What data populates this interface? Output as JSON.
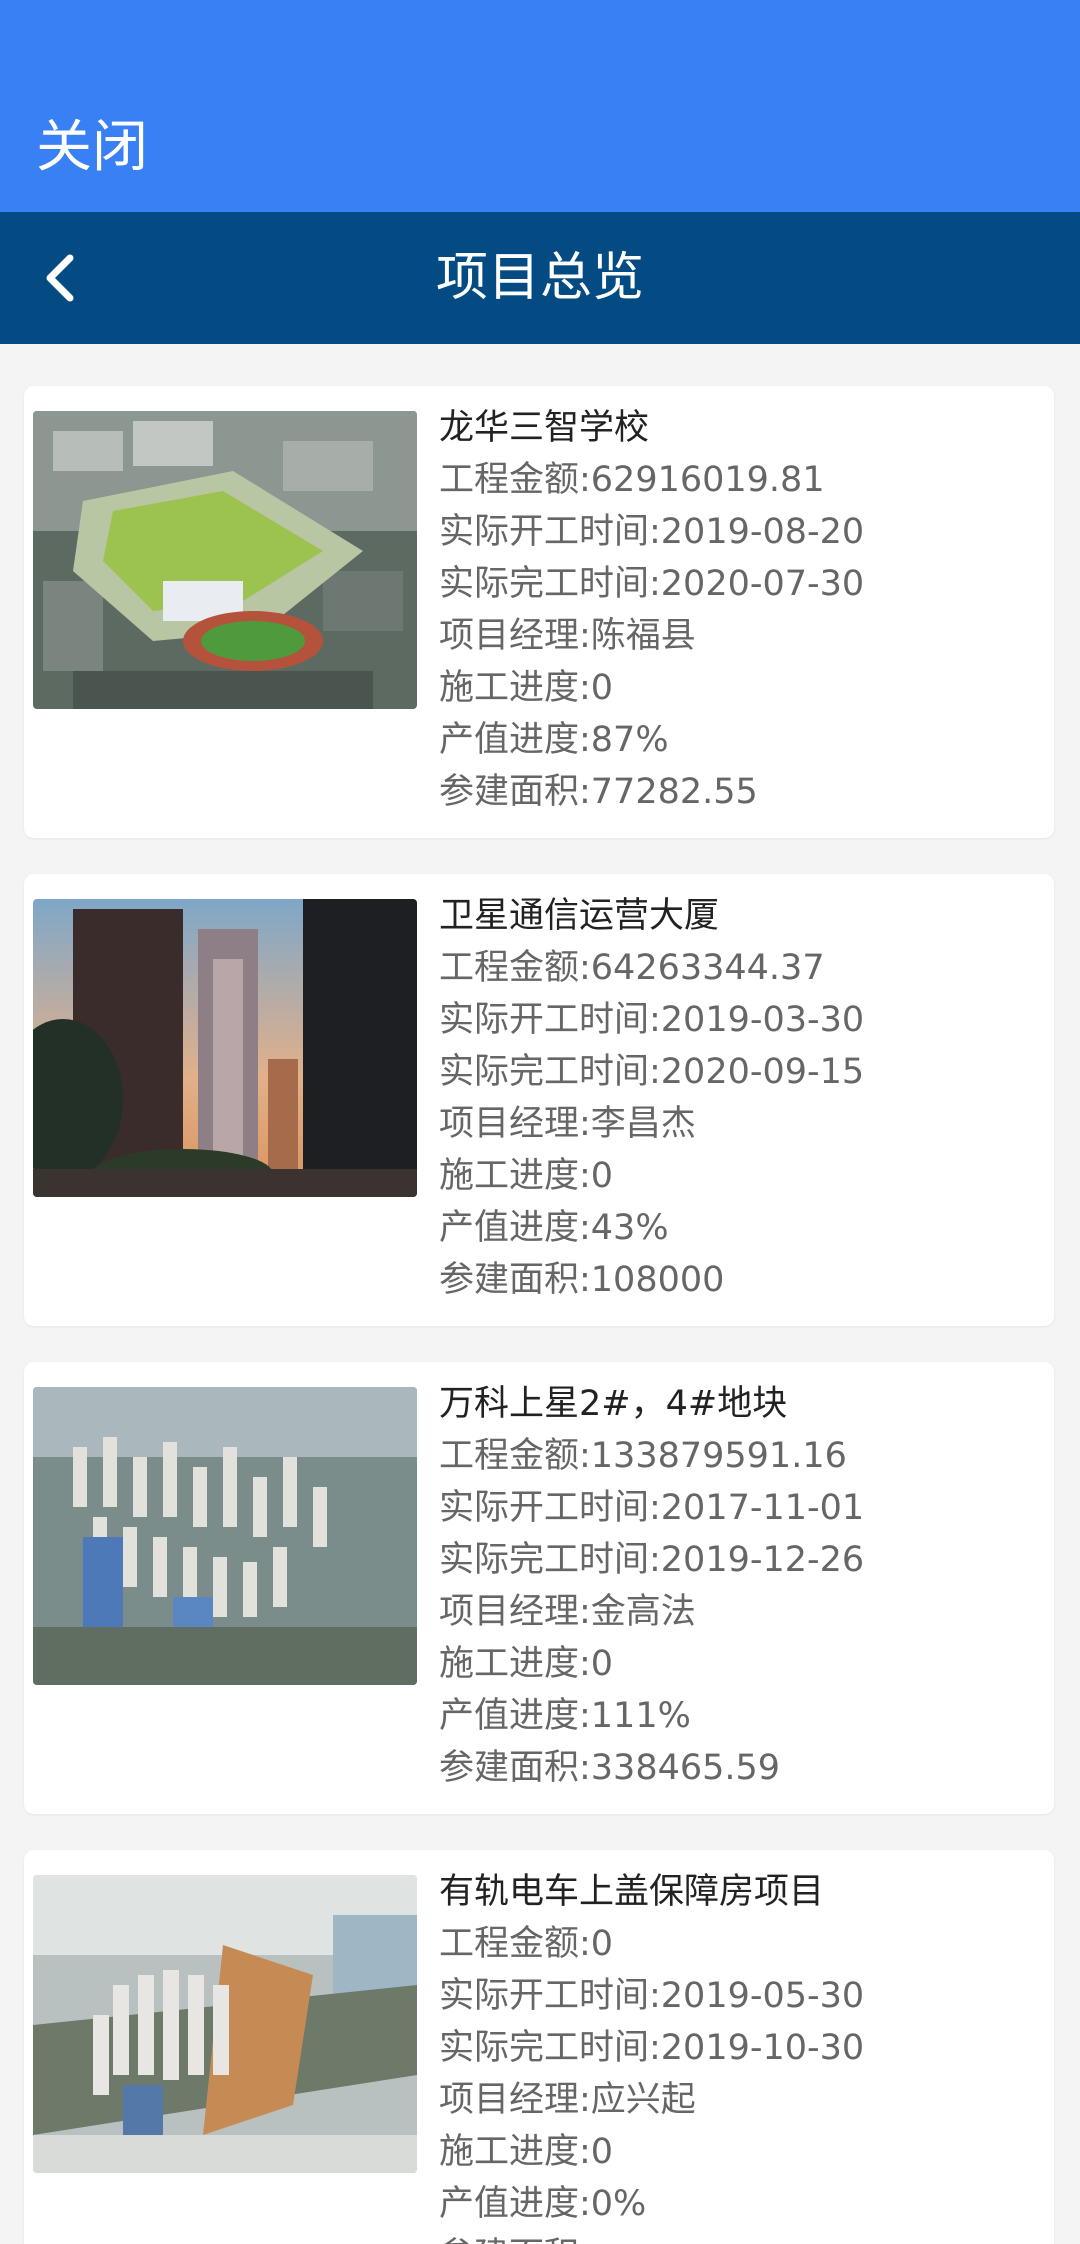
{
  "header": {
    "close_label": "关闭",
    "title": "项目总览",
    "topbar_color": "#3a80f5",
    "navbar_color": "#034b82"
  },
  "projects": [
    {
      "name": "龙华三智学校",
      "amount": "工程金额:62916019.81",
      "start": "实际开工时间:2019-08-20",
      "finish": "实际完工时间:2020-07-30",
      "manager": "项目经理:陈福县",
      "construction": "施工进度:0",
      "output": "产值进度:87%",
      "area": "参建面积:77282.55"
    },
    {
      "name": "卫星通信运营大厦",
      "amount": "工程金额:64263344.37",
      "start": "实际开工时间:2019-03-30",
      "finish": "实际完工时间:2020-09-15",
      "manager": "项目经理:李昌杰",
      "construction": "施工进度:0",
      "output": "产值进度:43%",
      "area": "参建面积:108000"
    },
    {
      "name": "万科上星2#，4#地块",
      "amount": "工程金额:133879591.16",
      "start": "实际开工时间:2017-11-01",
      "finish": "实际完工时间:2019-12-26",
      "manager": "项目经理:金高法",
      "construction": "施工进度:0",
      "output": "产值进度:111%",
      "area": "参建面积:338465.59"
    },
    {
      "name": "有轨电车上盖保障房项目",
      "amount": "工程金额:0",
      "start": "实际开工时间:2019-05-30",
      "finish": "实际完工时间:2019-10-30",
      "manager": "项目经理:应兴起",
      "construction": "施工进度:0",
      "output": "产值进度:0%",
      "area": "参建面积:"
    }
  ]
}
